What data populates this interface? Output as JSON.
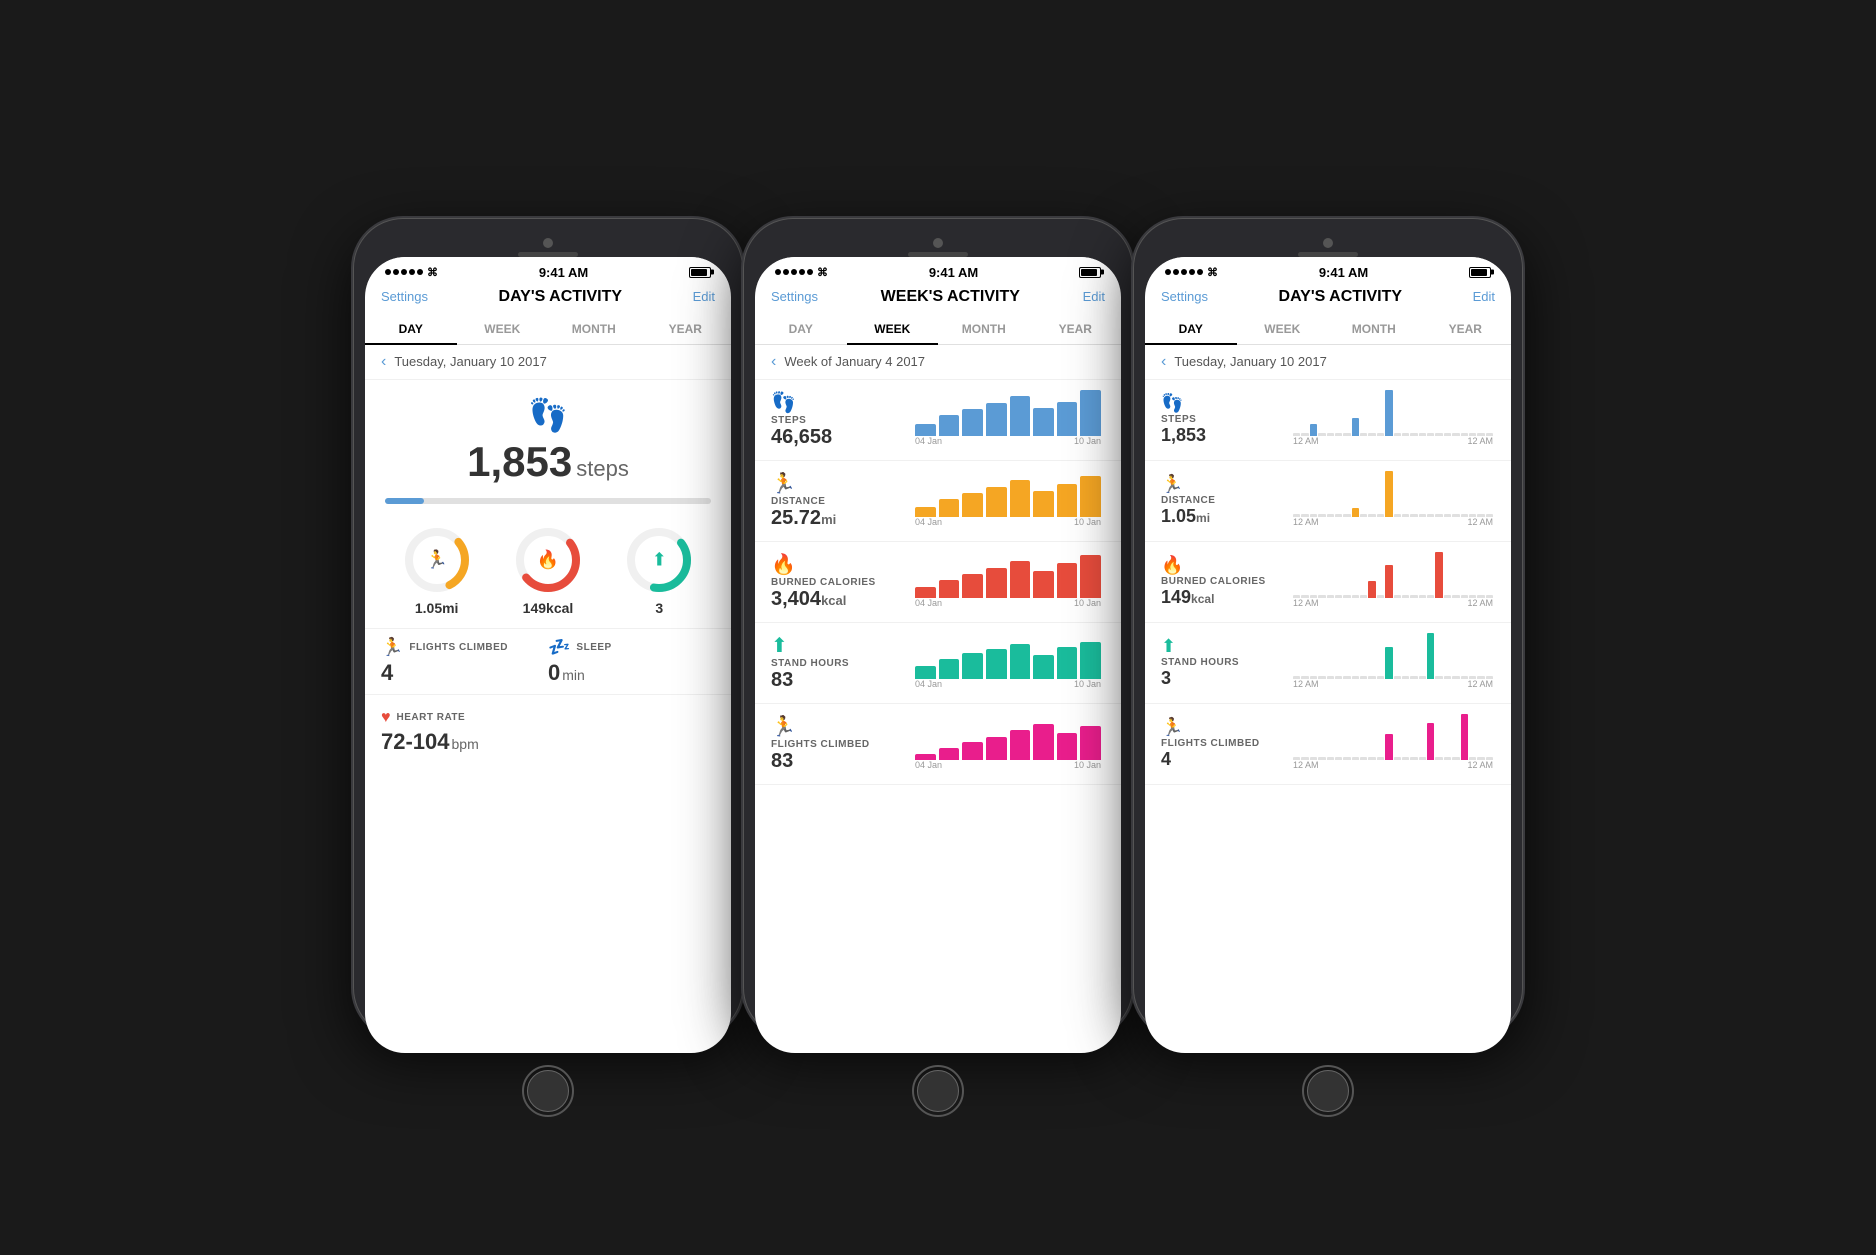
{
  "colors": {
    "blue": "#5b9bd5",
    "orange": "#f5a623",
    "red": "#e74c3c",
    "teal": "#1abc9c",
    "purple": "#9b59b6",
    "pink": "#e91e8c",
    "dark": "#333333",
    "light_gray": "#999999"
  },
  "phone1": {
    "status": {
      "time": "9:41 AM"
    },
    "nav": {
      "settings": "Settings",
      "title": "DAY'S ACTIVITY",
      "edit": "Edit"
    },
    "tabs": [
      "DAY",
      "WEEK",
      "MONTH",
      "YEAR"
    ],
    "active_tab": 0,
    "date": "Tuesday, January 10 2017",
    "steps": {
      "value": "1,853",
      "label": "steps"
    },
    "rings": [
      {
        "label": "1.05mi",
        "icon": "🏃",
        "color": "#f5a623",
        "percent": 30
      },
      {
        "label": "149kcal",
        "icon": "🔥",
        "color": "#e74c3c",
        "percent": 60
      },
      {
        "label": "3",
        "icon": "⬆",
        "color": "#1abc9c",
        "percent": 40
      }
    ],
    "stats": [
      {
        "icon": "flights",
        "label": "FLIGHTS CLIMBED",
        "value": "4",
        "unit": "",
        "color": "#9b59b6"
      },
      {
        "icon": "sleep",
        "label": "SLEEP",
        "value": "0",
        "unit": "min",
        "color": "#5b9bd5"
      },
      {
        "icon": "heart",
        "label": "HEART RATE",
        "value": "72-104",
        "unit": "bpm",
        "color": "#e74c3c"
      }
    ]
  },
  "phone2": {
    "status": {
      "time": "9:41 AM"
    },
    "nav": {
      "settings": "Settings",
      "title": "WEEK'S ACTIVITY",
      "edit": "Edit"
    },
    "tabs": [
      "DAY",
      "WEEK",
      "MONTH",
      "YEAR"
    ],
    "active_tab": 1,
    "date": "Week of January 4 2017",
    "items": [
      {
        "icon": "steps",
        "label": "STEPS",
        "value": "46,658",
        "unit": "",
        "color": "#5b9bd5",
        "bars": [
          20,
          35,
          45,
          55,
          65,
          48,
          70,
          75
        ]
      },
      {
        "icon": "distance",
        "label": "DISTANCE",
        "value": "25.72",
        "unit": "mi",
        "color": "#f5a623",
        "bars": [
          15,
          28,
          38,
          50,
          60,
          42,
          55,
          65
        ]
      },
      {
        "icon": "calories",
        "label": "BURNED CALORIES",
        "value": "3,404",
        "unit": "kcal",
        "color": "#e74c3c",
        "bars": [
          18,
          30,
          42,
          52,
          62,
          45,
          58,
          68
        ]
      },
      {
        "icon": "stand",
        "label": "STAND HOURS",
        "value": "83",
        "unit": "",
        "color": "#1abc9c",
        "bars": [
          22,
          33,
          44,
          50,
          58,
          40,
          55,
          60
        ]
      },
      {
        "icon": "flights",
        "label": "FLIGHTS CLIMBED",
        "value": "83",
        "unit": "",
        "color": "#e91e8c",
        "bars": [
          10,
          20,
          30,
          40,
          50,
          60,
          45,
          55
        ]
      }
    ],
    "chart_dates": {
      "start": "04 Jan",
      "end": "10 Jan"
    }
  },
  "phone3": {
    "status": {
      "time": "9:41 AM"
    },
    "nav": {
      "settings": "Settings",
      "title": "DAY'S ACTIVITY",
      "edit": "Edit"
    },
    "tabs": [
      "DAY",
      "WEEK",
      "MONTH",
      "YEAR"
    ],
    "active_tab": 0,
    "date": "Tuesday, January 10 2017",
    "items": [
      {
        "icon": "steps",
        "label": "STEPS",
        "value": "1,853",
        "unit": "",
        "color": "#5b9bd5",
        "bars": [
          0,
          0,
          5,
          0,
          0,
          0,
          0,
          8,
          0,
          0,
          0,
          15,
          0,
          0,
          0,
          0,
          0,
          0,
          0,
          0,
          0,
          0,
          0,
          0
        ]
      },
      {
        "icon": "distance",
        "label": "DISTANCE",
        "value": "1.05",
        "unit": "mi",
        "color": "#f5a623",
        "bars": [
          0,
          0,
          0,
          0,
          0,
          0,
          0,
          0,
          0,
          0,
          0,
          12,
          0,
          0,
          0,
          0,
          0,
          0,
          0,
          0,
          0,
          0,
          0,
          0
        ]
      },
      {
        "icon": "calories",
        "label": "BURNED CALORIES",
        "value": "149",
        "unit": "kcal",
        "color": "#e74c3c",
        "bars": [
          0,
          0,
          0,
          0,
          0,
          0,
          0,
          0,
          0,
          5,
          0,
          10,
          0,
          0,
          0,
          0,
          0,
          14,
          0,
          0,
          0,
          0,
          0,
          0
        ]
      },
      {
        "icon": "stand",
        "label": "STAND HOURS",
        "value": "3",
        "unit": "",
        "color": "#1abc9c",
        "bars": [
          0,
          0,
          0,
          0,
          0,
          0,
          0,
          0,
          0,
          0,
          0,
          10,
          0,
          0,
          0,
          0,
          15,
          0,
          0,
          0,
          0,
          0,
          0,
          0
        ]
      },
      {
        "icon": "flights",
        "label": "FLIGHTS CLIMBED",
        "value": "4",
        "unit": "",
        "color": "#e91e8c",
        "bars": [
          0,
          0,
          0,
          0,
          0,
          0,
          0,
          0,
          0,
          0,
          0,
          8,
          0,
          0,
          0,
          0,
          12,
          0,
          0,
          0,
          15,
          0,
          0,
          0
        ]
      }
    ],
    "chart_dates": {
      "start": "12 AM",
      "end": "12 AM"
    }
  }
}
